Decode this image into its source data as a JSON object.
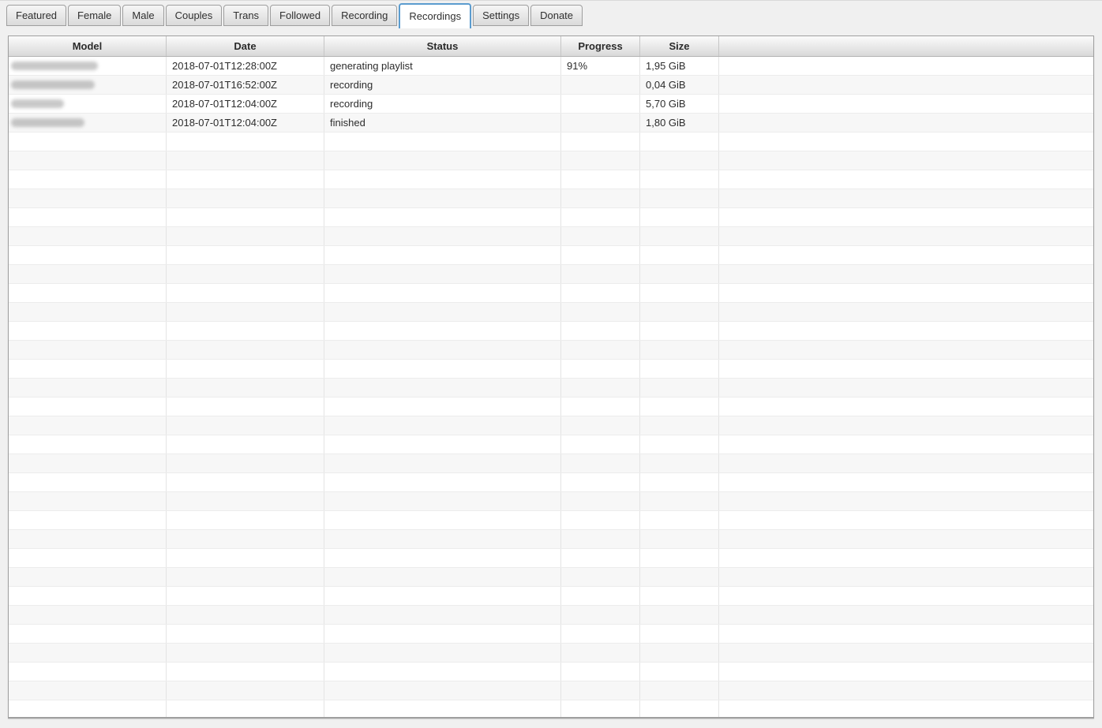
{
  "colors": {
    "window_background": "#f0f0f0",
    "active_tab_border": "#5b9ccf",
    "row_stripe": "#f7f7f7"
  },
  "tabs": [
    {
      "label": "Featured",
      "active": false
    },
    {
      "label": "Female",
      "active": false
    },
    {
      "label": "Male",
      "active": false
    },
    {
      "label": "Couples",
      "active": false
    },
    {
      "label": "Trans",
      "active": false
    },
    {
      "label": "Followed",
      "active": false
    },
    {
      "label": "Recording",
      "active": false
    },
    {
      "label": "Recordings",
      "active": true
    },
    {
      "label": "Settings",
      "active": false
    },
    {
      "label": "Donate",
      "active": false
    }
  ],
  "table": {
    "columns": [
      {
        "label": "Model"
      },
      {
        "label": "Date"
      },
      {
        "label": "Status"
      },
      {
        "label": "Progress"
      },
      {
        "label": "Size"
      },
      {
        "label": ""
      }
    ],
    "rows": [
      {
        "model_redacted": true,
        "model_blur_width": 110,
        "date": "2018-07-01T12:28:00Z",
        "status": "generating playlist",
        "progress": "91%",
        "size": "1,95 GiB"
      },
      {
        "model_redacted": true,
        "model_blur_width": 106,
        "date": "2018-07-01T16:52:00Z",
        "status": "recording",
        "progress": "",
        "size": "0,04 GiB"
      },
      {
        "model_redacted": true,
        "model_blur_width": 67,
        "date": "2018-07-01T12:04:00Z",
        "status": "recording",
        "progress": "",
        "size": "5,70 GiB"
      },
      {
        "model_redacted": true,
        "model_blur_width": 93,
        "date": "2018-07-01T12:04:00Z",
        "status": "finished",
        "progress": "",
        "size": "1,80 GiB"
      }
    ],
    "empty_row_count": 31
  }
}
